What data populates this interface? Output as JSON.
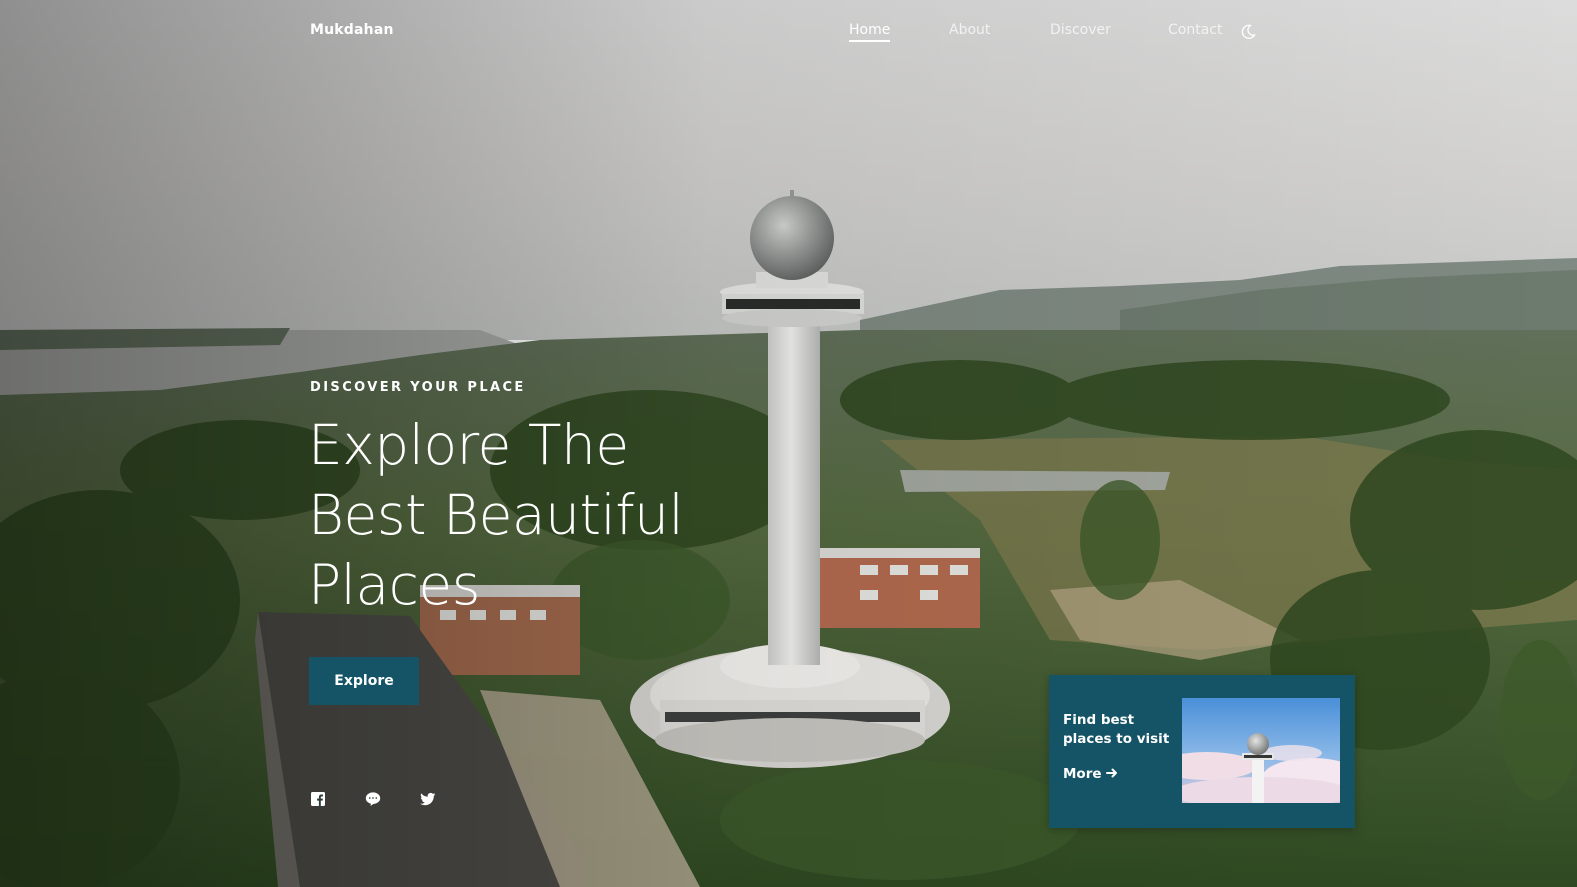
{
  "brand": {
    "name": "Mukdahan"
  },
  "nav": {
    "items": [
      {
        "label": "Home",
        "active": true
      },
      {
        "label": "About",
        "active": false
      },
      {
        "label": "Discover",
        "active": false
      },
      {
        "label": "Contact",
        "active": false
      }
    ],
    "theme_icon": "moon-icon"
  },
  "hero": {
    "eyebrow": "DISCOVER YOUR PLACE",
    "title_lines": [
      "Explore The",
      "Best Beautiful",
      "Places"
    ],
    "button_label": "Explore"
  },
  "social": [
    "facebook-icon",
    "line-chat-icon",
    "twitter-icon"
  ],
  "card": {
    "text": "Find best places to visit",
    "more_label": "More",
    "more_icon": "arrow-right-icon"
  },
  "colors": {
    "accent": "#145466",
    "text": "#ffffff"
  }
}
